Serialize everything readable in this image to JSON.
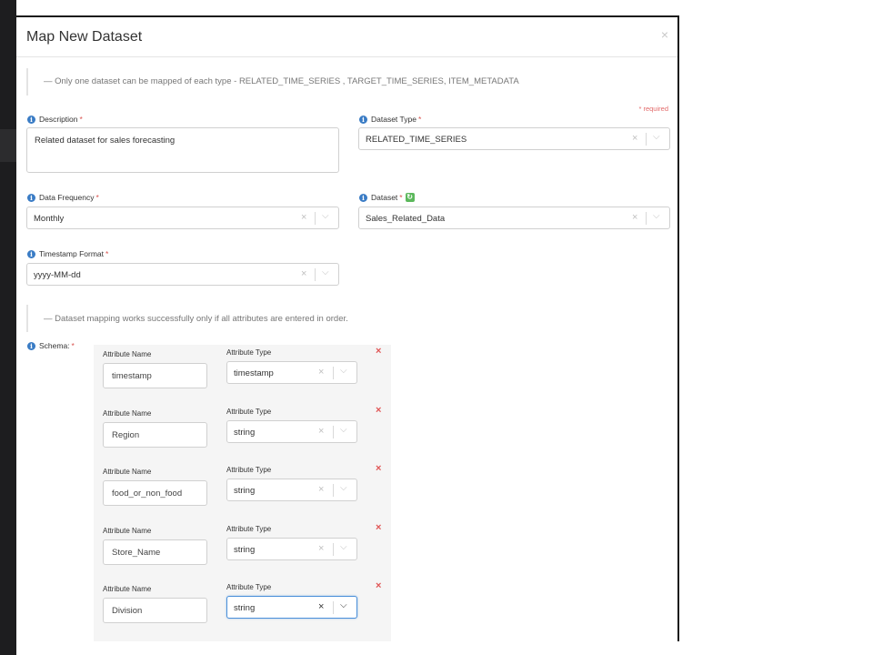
{
  "modal": {
    "title": "Map New Dataset",
    "close_label": "×",
    "note_top": "— Only one dataset can be mapped of each type - RELATED_TIME_SERIES , TARGET_TIME_SERIES, ITEM_METADATA",
    "required_note": "* required",
    "note_schema": "— Dataset mapping works successfully only if all attributes are entered in order."
  },
  "form": {
    "description": {
      "label": "Description",
      "value": "Related dataset for sales forecasting"
    },
    "dataset_type": {
      "label": "Dataset Type",
      "value": "RELATED_TIME_SERIES"
    },
    "data_frequency": {
      "label": "Data Frequency",
      "value": "Monthly"
    },
    "dataset": {
      "label": "Dataset",
      "value": "Sales_Related_Data"
    },
    "timestamp_format": {
      "label": "Timestamp Format",
      "value": "yyyy-MM-dd"
    },
    "schema": {
      "label": "Schema:"
    }
  },
  "required_mark": "*",
  "info_glyph": "i",
  "icons": {
    "clear": "×",
    "chevron": "⌵",
    "refresh": "↻",
    "remove": "×"
  },
  "schema_headers": {
    "name": "Attribute Name",
    "type": "Attribute Type"
  },
  "schema_rows": [
    {
      "name": "timestamp",
      "type": "timestamp"
    },
    {
      "name": "Region",
      "type": "string"
    },
    {
      "name": "food_or_non_food",
      "type": "string"
    },
    {
      "name": "Store_Name",
      "type": "string"
    },
    {
      "name": "Division",
      "type": "string"
    }
  ],
  "colors": {
    "accent": "#3a7cc5",
    "required": "#d9534f",
    "remove": "#e05555",
    "refresh": "#5cb85c",
    "focus": "#4a8fd9"
  }
}
